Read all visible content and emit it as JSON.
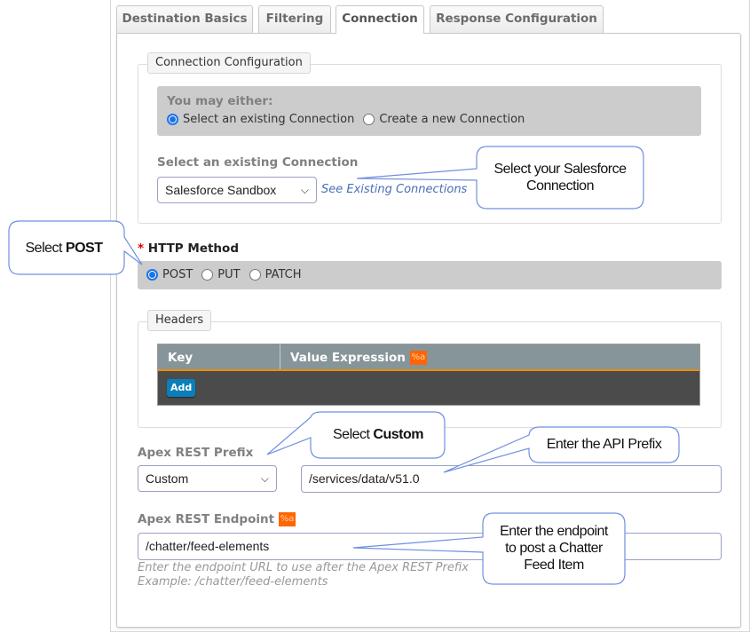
{
  "tabs": [
    {
      "label": "Destination Basics",
      "active": false
    },
    {
      "label": "Filtering",
      "active": false
    },
    {
      "label": "Connection",
      "active": true
    },
    {
      "label": "Response Configuration",
      "active": false
    }
  ],
  "connection_config": {
    "legend": "Connection Configuration",
    "choice_prompt": "You may either:",
    "choices": [
      {
        "label": "Select an existing Connection",
        "checked": true
      },
      {
        "label": "Create a new Connection",
        "checked": false
      }
    ],
    "select_label": "Select an existing Connection",
    "select_value": "Salesforce Sandbox",
    "see_existing_link": "See Existing Connections"
  },
  "http_method": {
    "required_mark": "*",
    "label": "HTTP Method",
    "options": [
      {
        "label": "POST",
        "checked": true
      },
      {
        "label": "PUT",
        "checked": false
      },
      {
        "label": "PATCH",
        "checked": false
      }
    ]
  },
  "headers": {
    "legend": "Headers",
    "columns": [
      "Key",
      "Value Expression"
    ],
    "expression_badge": "%a",
    "add_button": "Add"
  },
  "apex_prefix": {
    "label": "Apex REST Prefix",
    "select_value": "Custom",
    "input_value": "/services/data/v51.0"
  },
  "apex_endpoint": {
    "label": "Apex REST Endpoint",
    "expression_badge": "%a",
    "input_value": "/chatter/feed-elements",
    "help_line1": "Enter the endpoint URL to use after the Apex REST Prefix",
    "help_line2": "Example: /chatter/feed-elements"
  },
  "callouts": {
    "salesforce_connection": {
      "line1": "Select your Salesforce",
      "line2": "Connection"
    },
    "post": {
      "prefix": "Select ",
      "bold": "POST"
    },
    "custom": {
      "prefix": "Select ",
      "bold": "Custom"
    },
    "api_prefix": {
      "text": "Enter the API Prefix"
    },
    "endpoint": {
      "line1": "Enter the endpoint",
      "line2": "to post a Chatter",
      "line3": "Feed Item"
    }
  },
  "colors": {
    "tab_border": "#c8c8c8",
    "gray_box": "#cccccc",
    "table_header": "#86959a",
    "table_body": "#4b4b4b",
    "table_accent": "#f08c00",
    "add_button": "#0b7fba",
    "expression_badge": "#ff6600",
    "radio_checked": "#1a73e8",
    "link": "#4a6fb5",
    "callout_border": "#6f8fe0"
  }
}
